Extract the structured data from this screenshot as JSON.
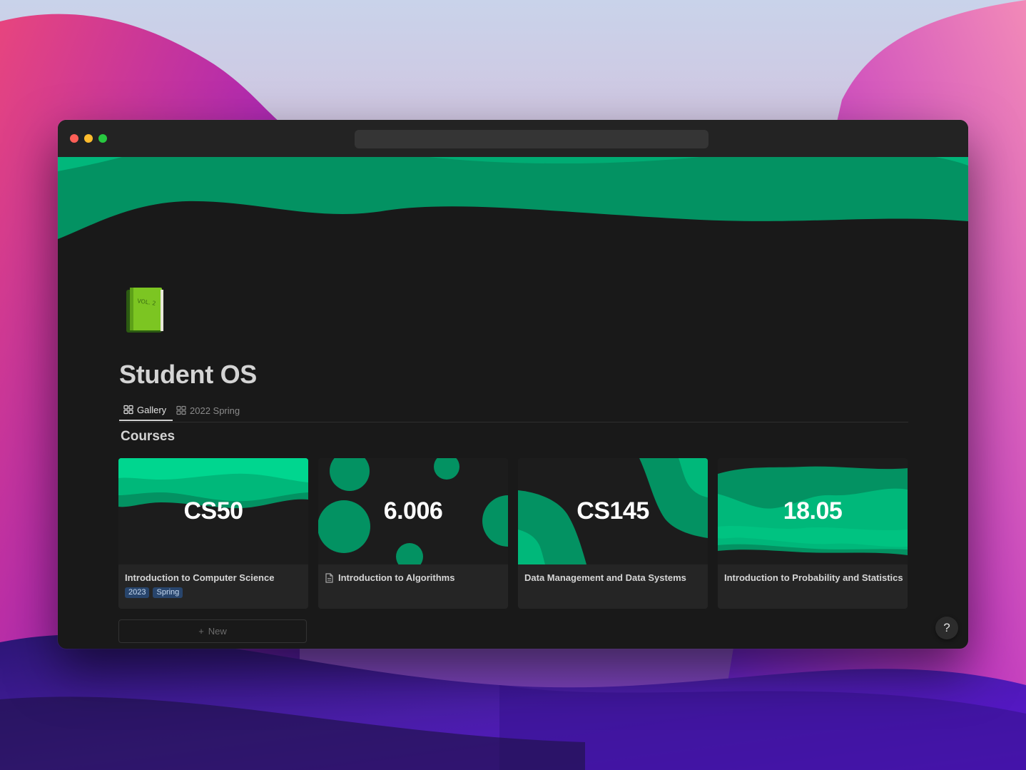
{
  "page": {
    "title": "Student OS",
    "icon": "green-book-icon",
    "icon_text": "VOL. 2"
  },
  "tabs": [
    {
      "label": "Gallery",
      "icon": "gallery-icon",
      "active": true
    },
    {
      "label": "2022 Spring",
      "icon": "gallery-icon",
      "active": false
    }
  ],
  "section": {
    "heading": "Courses"
  },
  "courses": [
    {
      "code": "CS50",
      "title": "Introduction to Computer Science",
      "tags": [
        "2023",
        "Spring"
      ],
      "has_page_icon": false
    },
    {
      "code": "6.006",
      "title": "Introduction to Algorithms",
      "tags": [],
      "has_page_icon": true
    },
    {
      "code": "CS145",
      "title": "Data Management and Data Systems",
      "tags": [],
      "has_page_icon": false
    },
    {
      "code": "18.05",
      "title": "Introduction to Probability and Statistics",
      "tags": [],
      "has_page_icon": false
    }
  ],
  "new_button": {
    "label": "New",
    "icon": "plus-icon"
  },
  "help_button": {
    "label": "?"
  },
  "colors": {
    "accent_green": "#039262",
    "light_green": "#00d68f",
    "mid_green": "#00b87a",
    "tag_blue": "#28456c",
    "page_background": "#191919"
  }
}
